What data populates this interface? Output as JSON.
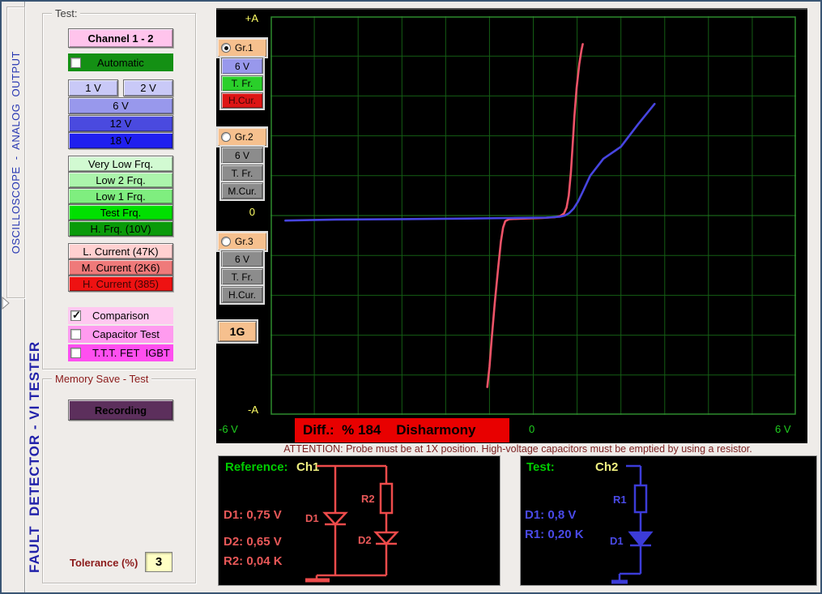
{
  "sidebar": {
    "tab_title": "OSCILLOSCOPE  -  ANALOG  OUTPUT",
    "app_title": "FAULT  DETECTOR - VI TESTER"
  },
  "test_panel": {
    "label": "Test:",
    "channel_button": {
      "label": "Channel 1 - 2",
      "color": "#ffc4ec"
    },
    "automatic": {
      "label": "Automatic",
      "checked": false,
      "color": "#149014"
    },
    "voltage_buttons": [
      {
        "label": "1 V",
        "color": "#c9c9f7"
      },
      {
        "label": "2 V",
        "color": "#c9c9f7"
      },
      {
        "label": "6 V",
        "color": "#9898ec"
      },
      {
        "label": "12 V",
        "color": "#4a4adf"
      },
      {
        "label": "18 V",
        "color": "#1f1fef"
      }
    ],
    "frequency_buttons": [
      {
        "label": "Very Low Frq.",
        "color": "#d2fad2"
      },
      {
        "label": "Low 2 Frq.",
        "color": "#acf5ac"
      },
      {
        "label": "Low 1 Frq.",
        "color": "#7fee7f"
      },
      {
        "label": "Test Frq.",
        "color": "#00e000"
      },
      {
        "label": "H. Frq. (10V)",
        "color": "#0a9a0a"
      }
    ],
    "current_buttons": [
      {
        "label": "L. Current (47K)",
        "color": "#ffd0d0"
      },
      {
        "label": "M. Current (2K6)",
        "color": "#ef7a7a"
      },
      {
        "label": "H. Current (385)",
        "color": "#ee1212"
      }
    ],
    "check_options": [
      {
        "label": "Comparison",
        "checked": true,
        "color": "#ffc8f0"
      },
      {
        "label": "Capacitor Test",
        "checked": false,
        "color": "#ff9bef"
      },
      {
        "label": "T.T.T. FET  IGBT",
        "checked": false,
        "color": "#ff4ff0"
      }
    ]
  },
  "memory_panel": {
    "label": "Memory Save - Test",
    "recording_button": {
      "label": "Recording",
      "color": "#5c2f5c"
    },
    "tolerance_label": "Tolerance (%)",
    "tolerance_value": "3"
  },
  "scope": {
    "gain_button": "1G",
    "y_labels": {
      "top": "+A",
      "zero": "0",
      "bottom": "-A"
    },
    "x_labels": {
      "left": "-6 V",
      "zero": "0",
      "right": "6 V"
    },
    "diff_bar": {
      "text": "Diff.:  % 184    Disharmony",
      "color": "#e80000"
    },
    "groups": [
      {
        "name": "Gr.1",
        "selected": true,
        "color": "#f6c08e",
        "buttons": [
          {
            "label": "6 V",
            "color": "#9898ec"
          },
          {
            "label": "T. Fr.",
            "color": "#2acf2a"
          },
          {
            "label": "H.Cur.",
            "color": "#dd1515"
          }
        ]
      },
      {
        "name": "Gr.2",
        "selected": false,
        "color": "#f6c08e",
        "buttons": [
          {
            "label": "6 V",
            "color": "#8c8c8c"
          },
          {
            "label": "T. Fr.",
            "color": "#8c8c8c"
          },
          {
            "label": "M.Cur.",
            "color": "#8c8c8c"
          }
        ]
      },
      {
        "name": "Gr.3",
        "selected": false,
        "color": "#f6c08e",
        "buttons": [
          {
            "label": "6 V",
            "color": "#8c8c8c"
          },
          {
            "label": "T. Fr.",
            "color": "#8c8c8c"
          },
          {
            "label": "H.Cur.",
            "color": "#8c8c8c"
          }
        ]
      }
    ]
  },
  "attention": "ATTENTION: Probe must be at 1X position. High-voltage capacitors must be emptied by using a resistor.",
  "chart_data": {
    "type": "line",
    "title": "VI characteristic comparison",
    "x_axis": {
      "min": -6,
      "max": 6,
      "unit": "V",
      "volts_per_div": 1,
      "ticks": [
        "-6 V",
        "0",
        "6 V"
      ]
    },
    "y_axis": {
      "min": -1,
      "max": 1,
      "labels": [
        "+A",
        "0",
        "-A"
      ]
    },
    "grid": {
      "cols": 12,
      "rows": 10,
      "color": "#145e14",
      "border_color": "#2e8b2e",
      "bg": "#000000"
    },
    "diff_percent": 184,
    "verdict": "Disharmony",
    "series": [
      {
        "name": "Reference (Ch1)",
        "color": "#ee5368",
        "points": [
          [
            -1.05,
            -0.86
          ],
          [
            -1.0,
            -0.76
          ],
          [
            -0.95,
            -0.62
          ],
          [
            -0.88,
            -0.44
          ],
          [
            -0.8,
            -0.26
          ],
          [
            -0.74,
            -0.13
          ],
          [
            -0.69,
            -0.06
          ],
          [
            -0.64,
            -0.028
          ],
          [
            -0.55,
            -0.018
          ],
          [
            -0.2,
            -0.015
          ],
          [
            0.2,
            -0.012
          ],
          [
            0.5,
            -0.008
          ],
          [
            0.62,
            -0.002
          ],
          [
            0.7,
            0.01
          ],
          [
            0.76,
            0.04
          ],
          [
            0.81,
            0.1
          ],
          [
            0.86,
            0.22
          ],
          [
            0.9,
            0.36
          ],
          [
            0.94,
            0.5
          ],
          [
            0.99,
            0.64
          ],
          [
            1.05,
            0.76
          ],
          [
            1.1,
            0.83
          ],
          [
            1.13,
            0.86
          ]
        ]
      },
      {
        "name": "Test (Ch2)",
        "color": "#4745e0",
        "points": [
          [
            -5.66,
            -0.025
          ],
          [
            -4.5,
            -0.02
          ],
          [
            -3.0,
            -0.018
          ],
          [
            -1.5,
            -0.015
          ],
          [
            -0.5,
            -0.012
          ],
          [
            0.3,
            -0.01
          ],
          [
            0.6,
            -0.006
          ],
          [
            0.72,
            0.0
          ],
          [
            0.82,
            0.012
          ],
          [
            0.92,
            0.035
          ],
          [
            1.02,
            0.07
          ],
          [
            1.12,
            0.115
          ],
          [
            1.3,
            0.2
          ],
          [
            1.6,
            0.285
          ],
          [
            2.0,
            0.345
          ],
          [
            2.4,
            0.46
          ],
          [
            2.77,
            0.56
          ]
        ]
      }
    ]
  },
  "reference_circuit": {
    "header": "Reference:",
    "header_color": "#00cc00",
    "channel": "Ch1",
    "channel_color": "#f0f080",
    "color": "#ee4b4b",
    "text_color": "#e85858",
    "values": [
      "D1: 0,75 V",
      "D2: 0,65 V",
      "R2: 0,04 K"
    ],
    "component_labels": {
      "d1": "D1",
      "r2": "R2",
      "d2": "D2"
    }
  },
  "test_circuit": {
    "header": "Test:",
    "header_color": "#00cc00",
    "channel": "Ch2",
    "channel_color": "#f0f080",
    "color": "#3c3cd8",
    "text_color": "#4a4ae8",
    "values": [
      "D1: 0,8 V",
      "R1: 0,20 K"
    ],
    "component_labels": {
      "r1": "R1",
      "d1": "D1"
    }
  }
}
